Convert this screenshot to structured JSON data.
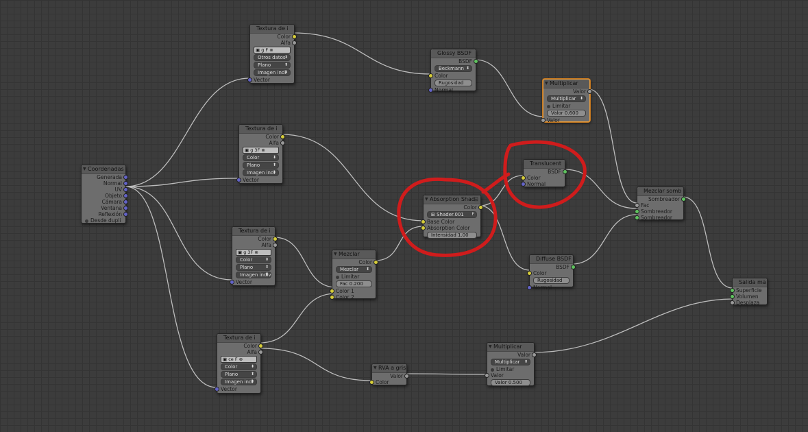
{
  "colors": {
    "background": "#3c3c3c",
    "node": "#6d6d6d",
    "selected_outline": "#e89c3c",
    "annotation": "#d01c1c",
    "socket_color": "#d6cd3a",
    "socket_value": "#9a9a9a",
    "socket_vector": "#6363c7",
    "socket_shader": "#5fc35f"
  },
  "coord": {
    "title": "Coordenadas",
    "outputs": [
      "Generada",
      "Normal",
      "UV",
      "Objeto",
      "Cámara",
      "Ventana",
      "Reflexión"
    ],
    "dupli": "Desde dupli"
  },
  "tex1": {
    "title": "Textura de i",
    "out_color": "Color",
    "out_alfa": "Alfa",
    "icons": "g  F  ",
    "source": "Otros datos",
    "proj": "Plano",
    "ext": "Imagen indi",
    "in_vector": "Vector"
  },
  "tex2": {
    "title": "Textura de i",
    "out_color": "Color",
    "out_alfa": "Alfa",
    "icons": "g  3F  ",
    "source": "Color",
    "proj": "Plano",
    "ext": "Imagen indi",
    "in_vector": "Vector"
  },
  "tex3": {
    "title": "Textura de i",
    "out_color": "Color",
    "out_alfa": "Alfa",
    "icons": "g  3F  ",
    "source": "Color",
    "proj": "Plano",
    "ext": "Imagen indiv",
    "in_vector": "Vector"
  },
  "tex4": {
    "title": "Textura de i",
    "out_color": "Color",
    "out_alfa": "Alfa",
    "icons": "ce  F  ",
    "source": "Color",
    "proj": "Plano",
    "ext": "Imagen indi",
    "in_vector": "Vector"
  },
  "glossy": {
    "title": "Glossy BSDF",
    "out": "BSDF",
    "dist": "Beckmann",
    "in_color": "Color",
    "rough": "Rugosidad",
    "normal": "Normal"
  },
  "mult1": {
    "title": "Multiplicar",
    "out": "Valor",
    "op": "Multiplicar",
    "clamp": "Limitar",
    "value": "Valor 0.600",
    "in_val": "Valor"
  },
  "translucent": {
    "title": "Translucent",
    "out": "BSDF",
    "in_color": "Color",
    "normal": "Normal"
  },
  "absorption": {
    "title": "Absorption Shad",
    "out": "Color",
    "shader": "Shader.001",
    "f": "F",
    "base": "Base Color",
    "abs": "Absorption Color",
    "intensity": "Intensidad 1.00"
  },
  "mix_shader": {
    "title": "Mezclar somb",
    "out": "Sombreador",
    "fac": "Fac",
    "s1": "Sombreador",
    "s2": "Sombreador"
  },
  "mezclar": {
    "title": "Mezclar",
    "out": "Color",
    "mode": "Mezclar",
    "clamp": "Limitar",
    "fac": "Fac 0.200",
    "c1": "Color 1",
    "c2": "Color 2"
  },
  "diffuse": {
    "title": "Diffuse BSDF",
    "out": "BSDF",
    "in_color": "Color",
    "rough": "Rugosidad",
    "normal": "Normal"
  },
  "output": {
    "title": "Salida ma",
    "surface": "Superficie",
    "volume": "Volumen",
    "disp": "Desplaza"
  },
  "rgb2bw": {
    "title": "RVA a gris",
    "out": "Valor",
    "in_color": "Color"
  },
  "mult2": {
    "title": "Multiplicar",
    "out": "Valor",
    "op": "Multiplicar",
    "clamp": "Limitar",
    "in_val": "Valor",
    "value": "Valor 0.500"
  }
}
